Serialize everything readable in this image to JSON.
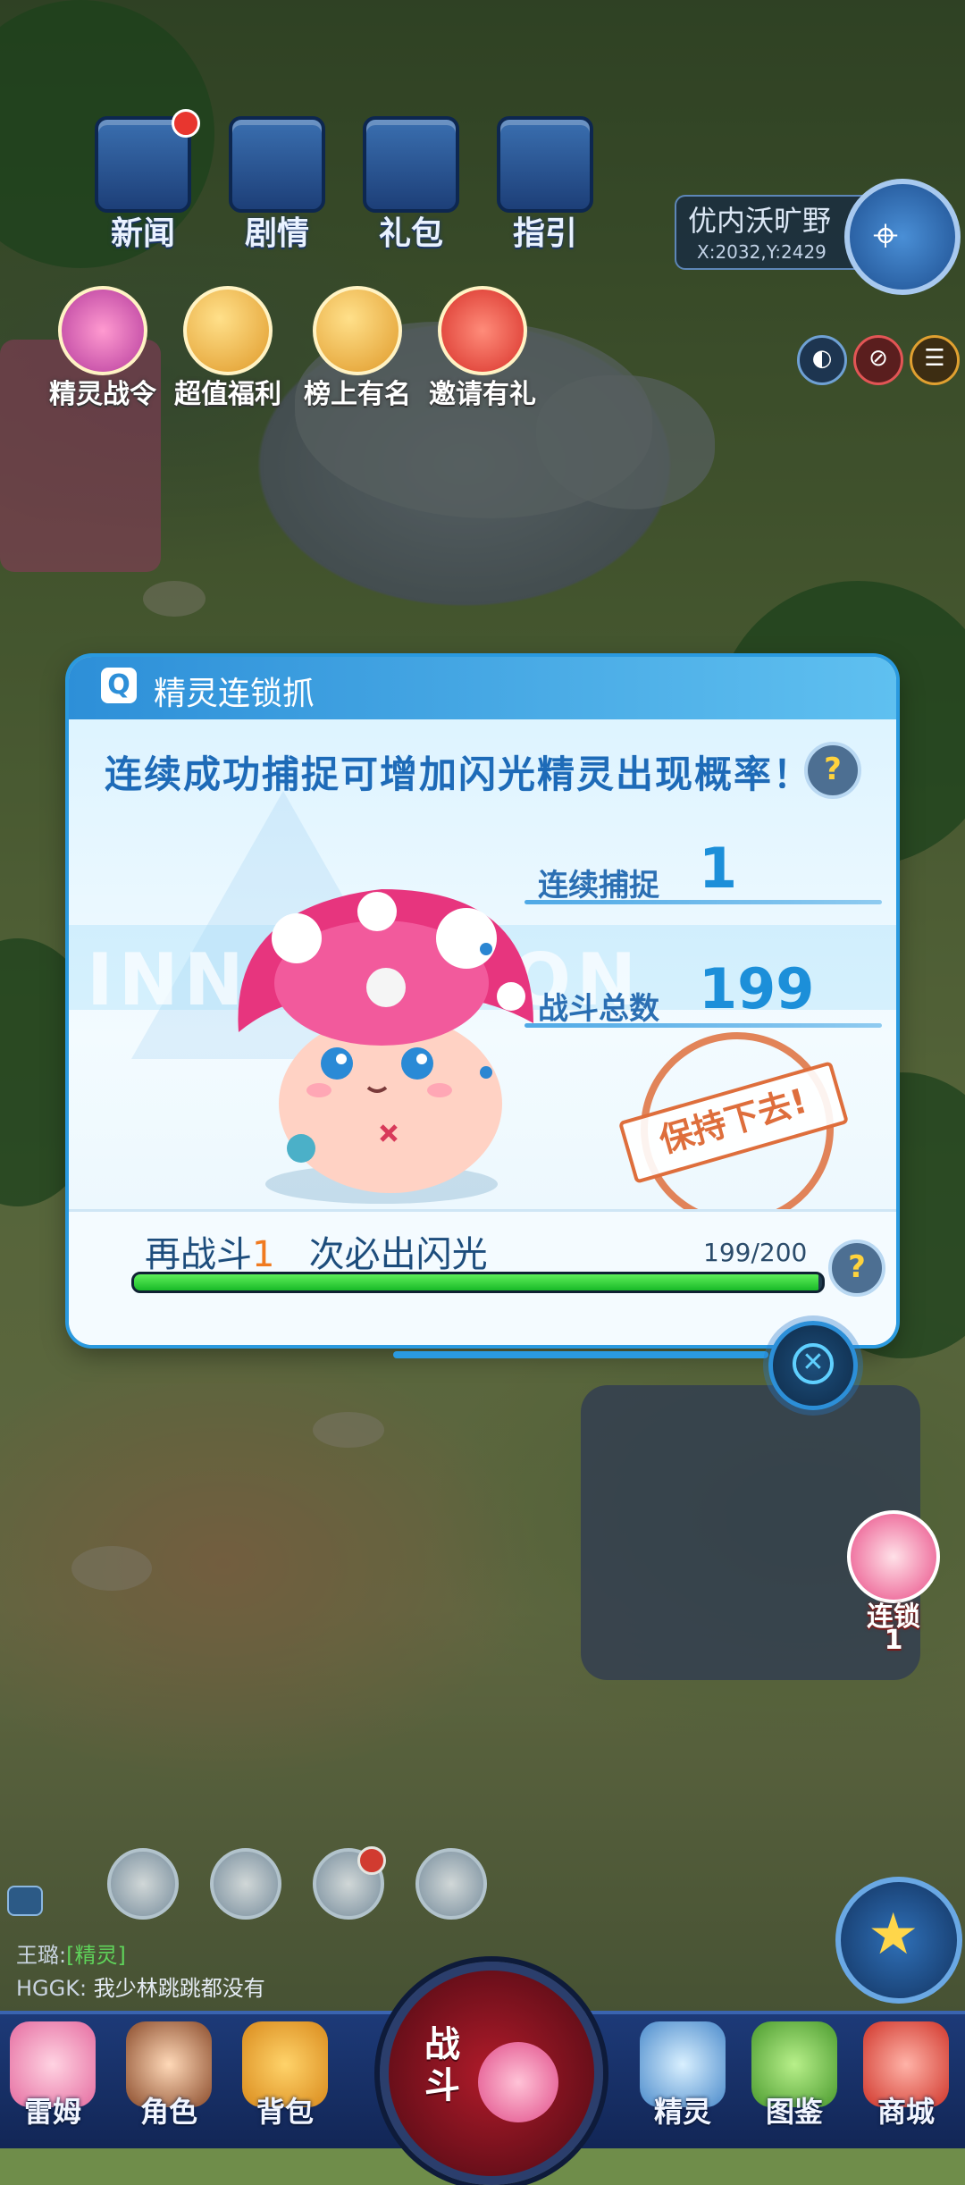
{
  "top_icons": [
    {
      "label": "新闻",
      "badge": true
    },
    {
      "label": "剧情",
      "badge": false
    },
    {
      "label": "礼包",
      "badge": false
    },
    {
      "label": "指引",
      "badge": false
    }
  ],
  "feature_icons": [
    {
      "label": "精灵战令"
    },
    {
      "label": "超值福利"
    },
    {
      "label": "榜上有名"
    },
    {
      "label": "邀请有礼"
    }
  ],
  "location": {
    "name": "优内沃旷野",
    "coords": "X:2032,Y:2429"
  },
  "modal": {
    "title": "精灵连锁抓",
    "subtitle": "连续成功捕捉可增加闪光精灵出现概率！",
    "bg_text": "INNOVATION",
    "consecutive_label": "连续捕捉",
    "consecutive_value": "1",
    "total_label": "战斗总数",
    "total_value": "199",
    "stamp": "保持下去!",
    "remaining_prefix": "再战斗",
    "remaining_value": "1",
    "remaining_suffix": "次必出闪光",
    "progress_text": "199/200",
    "progress_fraction": 0.995,
    "help_glyph": "?",
    "close_glyph": "✕"
  },
  "streak": {
    "label": "连锁",
    "value": "1"
  },
  "chat": [
    {
      "user": "王璐:",
      "text": "[精灵]"
    },
    {
      "user": "HGGK:",
      "text": "我少林跳跳都没有"
    }
  ],
  "fight_label": "战斗",
  "nav": [
    {
      "label": "雷姆"
    },
    {
      "label": "角色"
    },
    {
      "label": "背包"
    },
    {
      "label": "精灵"
    },
    {
      "label": "图鉴"
    },
    {
      "label": "商城"
    }
  ],
  "colors": {
    "accent": "#2d8fd8",
    "progress_green": "#18b928",
    "highlight_orange": "#f07a20",
    "stamp": "#de6e3c"
  }
}
